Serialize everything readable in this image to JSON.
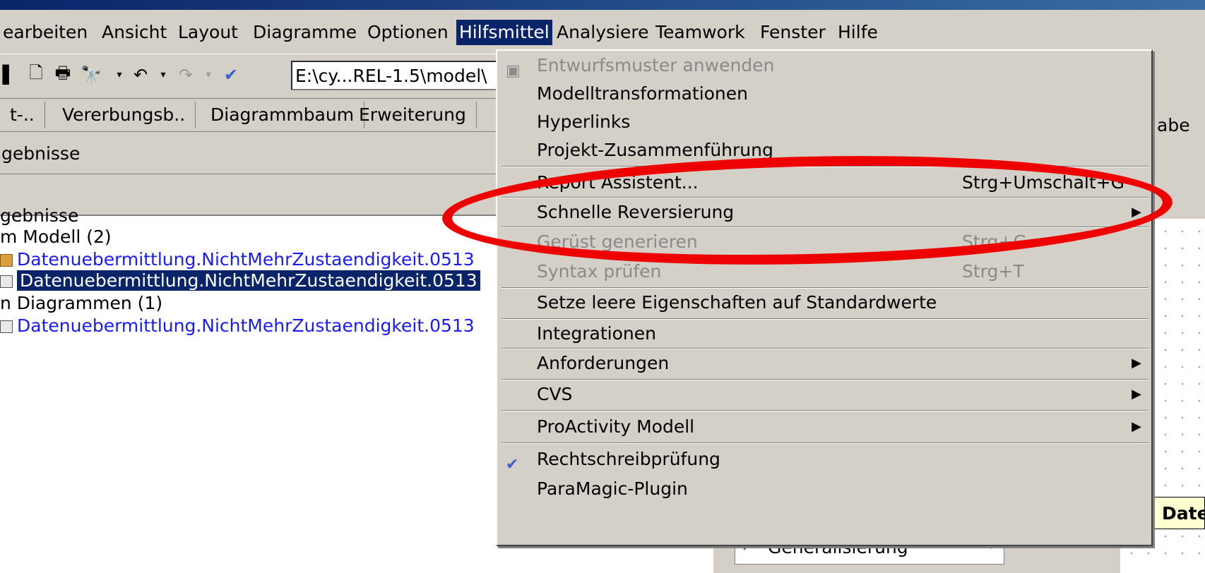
{
  "menubar": {
    "items": [
      "earbeiten",
      "Ansicht",
      "Layout",
      "Diagramme",
      "Optionen",
      "Hilfsmittel",
      "Analysiere",
      "Teamwork",
      "Fenster",
      "Hilfe"
    ],
    "active_index": 5
  },
  "toolbar": {
    "path_value": "E:\\cy...REL-1.5\\model\\",
    "icons": [
      "save-icon",
      "new-document-icon",
      "print-preview-icon",
      "find-icon",
      "undo-icon",
      "redo-icon",
      "spellcheck-icon"
    ]
  },
  "tabs": [
    "t-..",
    "Vererbungsb..",
    "Diagrammbaum",
    "Erweiterung"
  ],
  "results": {
    "header": "gebnisse",
    "tree": [
      {
        "text": "gebnisse",
        "kind": "plain"
      },
      {
        "text": "m Modell (2)",
        "kind": "plain"
      },
      {
        "text": "Datenuebermittlung.NichtMehrZustaendigkeit.0513",
        "kind": "link",
        "icon": "class-icon"
      },
      {
        "text": "Datenuebermittlung.NichtMehrZustaendigkeit.0513",
        "kind": "selected",
        "icon": "diagram-icon"
      },
      {
        "text": "n Diagrammen (1)",
        "kind": "plain"
      },
      {
        "text": "Datenuebermittlung.NichtMehrZustaendigkeit.0513",
        "kind": "link",
        "icon": "diagram-icon"
      }
    ]
  },
  "dropdown": {
    "items": [
      {
        "label": "Entwurfsmuster anwenden",
        "disabled": true,
        "icon": "pattern-icon"
      },
      {
        "label": "Modelltransformationen"
      },
      {
        "label": "Hyperlinks"
      },
      {
        "label": "Projekt-Zusammenführung"
      },
      {
        "label": "Report Assistent...",
        "shortcut": "Strg+Umschalt+G"
      },
      {
        "label": "Schnelle Reversierung",
        "submenu": true
      },
      {
        "label": "Gerüst generieren",
        "shortcut": "Strg+G",
        "disabled": true
      },
      {
        "label": "Syntax prüfen",
        "shortcut": "Strg+T",
        "disabled": true
      },
      {
        "label": "Setze leere Eigenschaften auf Standardwerte"
      },
      {
        "label": "Integrationen"
      },
      {
        "label": "Anforderungen",
        "submenu": true
      },
      {
        "label": "CVS",
        "submenu": true
      },
      {
        "label": "ProActivity Modell",
        "submenu": true
      },
      {
        "label": "Rechtschreibprüfung",
        "icon": "spellcheck-icon"
      },
      {
        "label": "ParaMagic-Plugin"
      }
    ]
  },
  "right_panel": {
    "tab_label": "abe",
    "box_label": "Date"
  },
  "palette": {
    "selected": "Generalisierung"
  },
  "colors": {
    "highlight": "#0a246a",
    "link": "#1a1aff",
    "annotation": "#ee0000",
    "window": "#d4d0c8"
  }
}
